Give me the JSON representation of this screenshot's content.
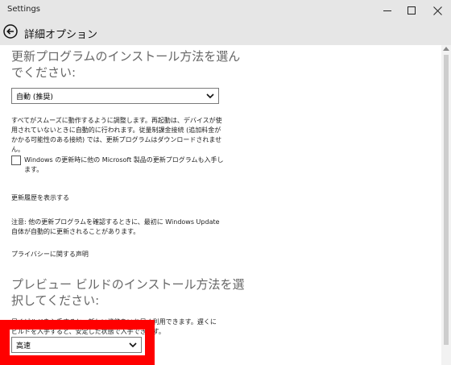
{
  "window": {
    "title": "Settings"
  },
  "header": {
    "title": "詳細オプション"
  },
  "section1": {
    "heading": "更新プログラムのインストール方法を選んでください:",
    "dropdown_value": "自動 (推奨)",
    "description": "すべてがスムーズに動作するように調整します。再起動は、デバイスが使用されていないときに自動的に行われます。従量制課金接続 (追加料金がかかる可能性のある接続) では、更新プログラムはダウンロードされません。",
    "checkbox_label": "Windows の更新時に他の Microsoft 製品の更新プログラムも入手します。",
    "checkbox_checked": false,
    "history_link": "更新履歴を表示する",
    "note": "注意: 他の更新プログラムを確認するときに、最初に Windows Update 自体が自動的に更新されることがあります。",
    "privacy_link": "プライバシーに関する声明"
  },
  "section2": {
    "heading": "プレビュー ビルドのインストール方法を選択してください:",
    "description": "早くビルドを入手すると、新しい機能をいち早く利用できます。遅くにビルドを入手すると、安定した状態で入手できます。",
    "dropdown_value": "高速"
  },
  "colors": {
    "highlight": "#ff0000",
    "chrome": "#e6e6e6"
  }
}
